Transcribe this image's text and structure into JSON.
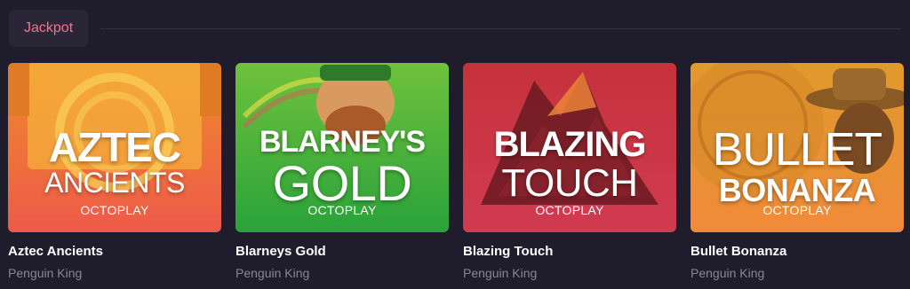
{
  "section": {
    "tab_label": "Jackpot"
  },
  "colors": {
    "background": "#1f1c2c",
    "tab_bg": "#2a2637",
    "accent": "#ff6f8e",
    "subtext": "#8a8699"
  },
  "games": [
    {
      "title": "Aztec Ancients",
      "studio": "Penguin King",
      "provider_badge": "OCTOPLAY",
      "logo_line1": "AZTEC",
      "logo_line2": "ANCIENTS",
      "theme": "orange-aztec"
    },
    {
      "title": "Blarneys Gold",
      "studio": "Penguin King",
      "provider_badge": "OCTOPLAY",
      "logo_line1": "BLARNEY'S",
      "logo_line2": "GOLD",
      "theme": "green-leprechaun"
    },
    {
      "title": "Blazing Touch",
      "studio": "Penguin King",
      "provider_badge": "OCTOPLAY",
      "logo_line1": "BLAZING",
      "logo_line2": "TOUCH",
      "theme": "red-volcano"
    },
    {
      "title": "Bullet Bonanza",
      "studio": "Penguin King",
      "provider_badge": "OCTOPLAY",
      "logo_line1": "BULLET",
      "logo_line2": "BONANZA",
      "theme": "gold-cowboy"
    }
  ]
}
